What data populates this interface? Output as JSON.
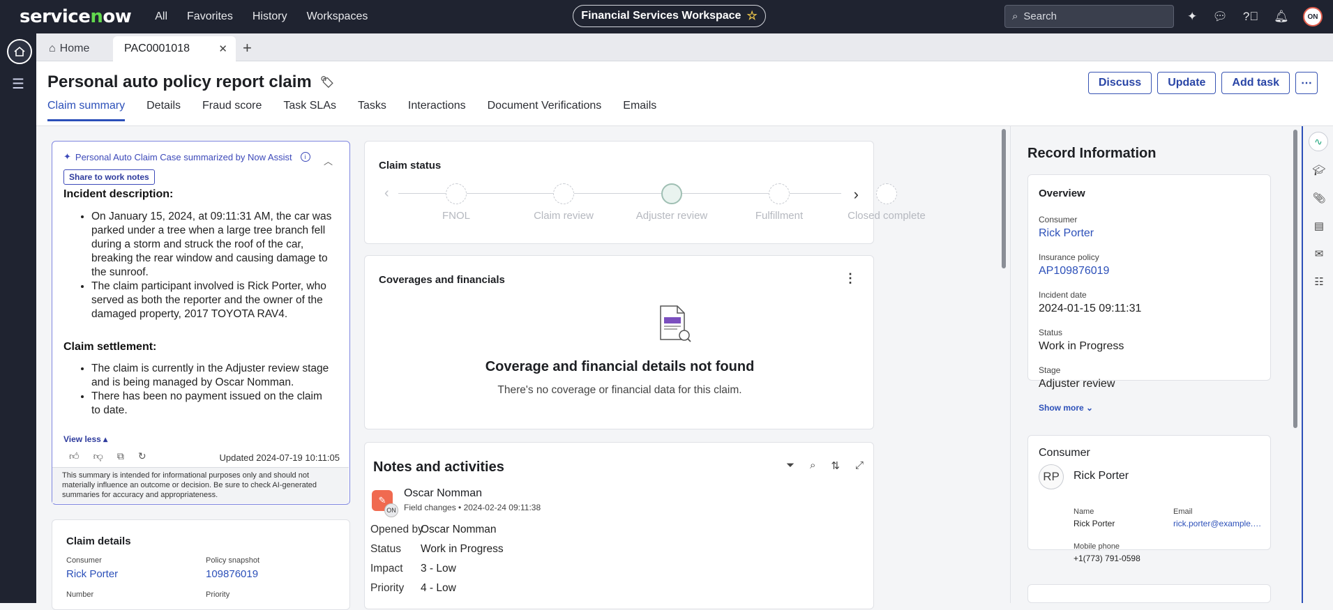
{
  "topbar": {
    "logo": "servicenow",
    "nav": [
      "All",
      "Favorites",
      "History",
      "Workspaces"
    ],
    "workspace_title": "Financial Services Workspace",
    "search_placeholder": "Search",
    "avatar_initials": "ON"
  },
  "tabs": {
    "home_label": "Home",
    "active_label": "PAC0001018"
  },
  "page": {
    "title": "Personal auto policy report claim",
    "actions": [
      "Discuss",
      "Update",
      "Add task"
    ],
    "subtabs": [
      "Claim summary",
      "Details",
      "Fraud score",
      "Task SLAs",
      "Tasks",
      "Interactions",
      "Document Verifications",
      "Emails"
    ]
  },
  "assist": {
    "header": "Personal Auto Claim Case summarized by Now Assist",
    "share_label": "Share to work notes",
    "incident_heading": "Incident description:",
    "incident_items": [
      "On January 15, 2024, at 09:11:31 AM, the car was parked under a tree when a large tree branch fell during a storm and struck the roof of the car, breaking the rear window and causing damage to the sunroof.",
      "The claim participant involved is Rick Porter, who served as both the reporter and the owner of the damaged property, 2017 TOYOTA RAV4."
    ],
    "settlement_heading": "Claim settlement:",
    "settlement_items": [
      "The claim is currently in the Adjuster review stage and is being managed by Oscar Nomman.",
      "There has been no payment issued on the claim to date."
    ],
    "view_less": "View less",
    "updated": "Updated 2024-07-19 10:11:05",
    "disclaimer": "This summary is intended for informational purposes only and should not materially influence an outcome or decision. Be sure to check AI-generated summaries for accuracy and appropriateness."
  },
  "claim_details": {
    "title": "Claim details",
    "consumer_label": "Consumer",
    "consumer_value": "Rick Porter",
    "policy_label": "Policy snapshot",
    "policy_value": "109876019",
    "number_label": "Number",
    "priority_label": "Priority"
  },
  "claim_status": {
    "title": "Claim status",
    "steps": [
      "FNOL",
      "Claim review",
      "Adjuster review",
      "Fulfillment",
      "Closed complete"
    ],
    "current_index": 2
  },
  "coverage": {
    "title": "Coverages and financials",
    "empty_heading": "Coverage and financial details not found",
    "empty_text": "There's no coverage or financial data for this claim."
  },
  "notes": {
    "title": "Notes and activities",
    "author": "Oscar Nomman",
    "author_initials": "ON",
    "meta": "Field changes • 2024-02-24 09:11:38",
    "fields": [
      {
        "label": "Opened by",
        "value": "Oscar Nomman"
      },
      {
        "label": "Status",
        "value": "Work in Progress"
      },
      {
        "label": "Impact",
        "value": "3 - Low"
      },
      {
        "label": "Priority",
        "value": "4 - Low"
      }
    ]
  },
  "record": {
    "title": "Record Information",
    "overview_heading": "Overview",
    "fields": [
      {
        "label": "Consumer",
        "value": "Rick Porter",
        "link": true
      },
      {
        "label": "Insurance policy",
        "value": "AP109876019",
        "link": true
      },
      {
        "label": "Incident date",
        "value": "2024-01-15 09:11:31",
        "link": false
      },
      {
        "label": "Status",
        "value": "Work in Progress",
        "link": false
      },
      {
        "label": "Stage",
        "value": "Adjuster review",
        "link": false
      }
    ],
    "show_more": "Show more",
    "consumer_heading": "Consumer",
    "consumer_initials": "RP",
    "consumer_name": "Rick Porter",
    "name_label": "Name",
    "name_value": "Rick Porter",
    "email_label": "Email",
    "email_value": "rick.porter@example.com",
    "phone_label": "Mobile phone",
    "phone_value": "+1(773) 791-0598"
  }
}
